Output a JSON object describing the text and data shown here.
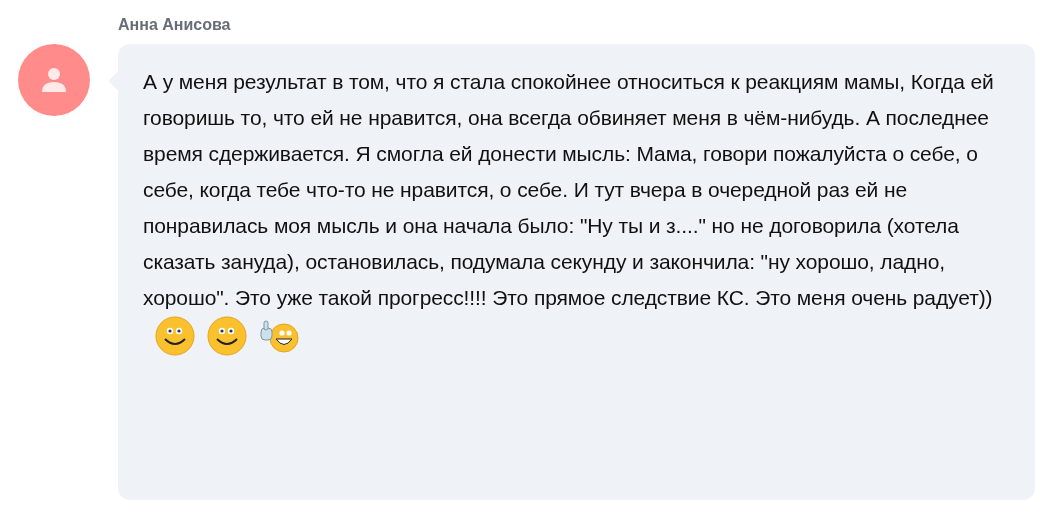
{
  "message": {
    "author": "Анна Анисова",
    "text": "А у меня результат в том, что я стала спокойнее относиться к реакциям мамы, Когда ей говоришь то, что ей не нравится, она всегда обвиняет меня в чём-нибудь. А последнее время сдерживается. Я смогла ей донести мысль: Мама, говори пожалуйста о себе, о себе, когда тебе что-то не нравится, о себе. И тут вчера в очередной раз ей не понравилась моя мысль и она начала было: \"Ну ты и з....\" но не договорила (хотела сказать зануда), остановилась, подумала секунду и закончила: \"ну хорошо, ладно, хорошо\". Это уже такой прогресс!!!! Это прямое следствие КС. Это меня очень радует))",
    "emojis": [
      {
        "kind": "smile"
      },
      {
        "kind": "smile"
      },
      {
        "kind": "thumbs-up"
      }
    ]
  }
}
